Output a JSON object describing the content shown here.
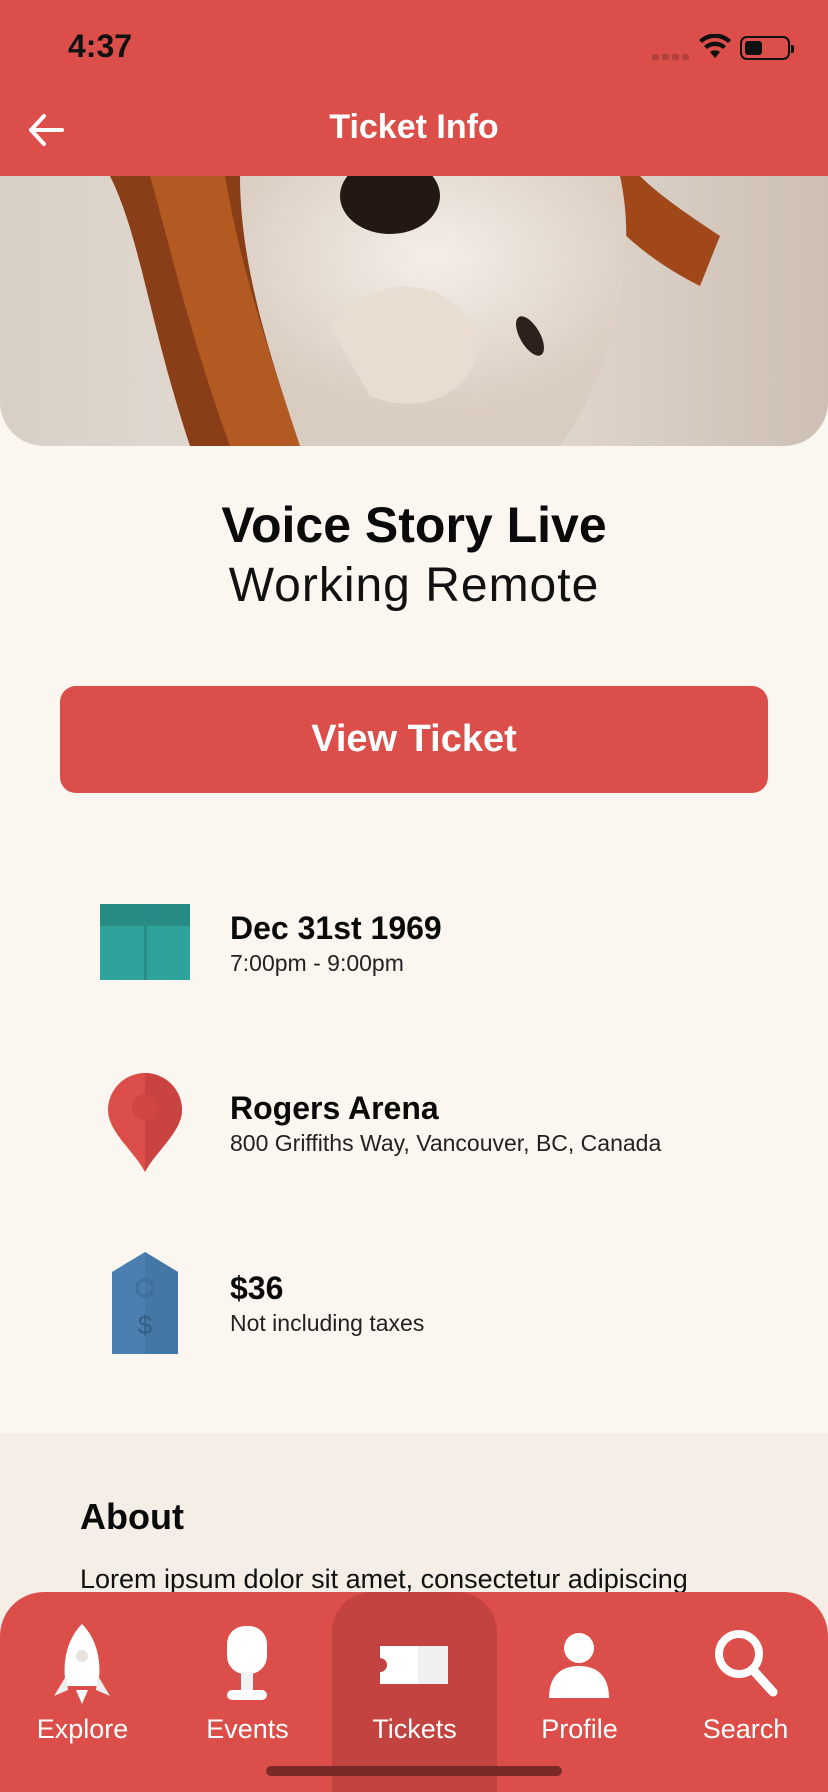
{
  "status_bar": {
    "time": "4:37"
  },
  "header": {
    "title": "Ticket Info"
  },
  "event": {
    "name": "Voice Story Live",
    "subtitle": "Working Remote"
  },
  "actions": {
    "view_ticket": "View Ticket"
  },
  "details": {
    "date": {
      "title": "Dec 31st 1969",
      "subtitle": "7:00pm - 9:00pm",
      "icon": "calendar-icon"
    },
    "location": {
      "title": "Rogers Arena",
      "subtitle": "800 Griffiths Way, Vancouver, BC, Canada",
      "icon": "map-pin-icon"
    },
    "price": {
      "title": "$36",
      "subtitle": "Not including taxes",
      "icon": "price-tag-icon"
    }
  },
  "about": {
    "heading": "About",
    "text": "Lorem ipsum dolor sit amet, consectetur adipiscing"
  },
  "tabbar": {
    "active": "Tickets",
    "items": [
      {
        "label": "Explore",
        "icon": "rocket-icon"
      },
      {
        "label": "Events",
        "icon": "microphone-icon"
      },
      {
        "label": "Tickets",
        "icon": "ticket-icon"
      },
      {
        "label": "Profile",
        "icon": "person-icon"
      },
      {
        "label": "Search",
        "icon": "search-icon"
      }
    ]
  },
  "colors": {
    "brand": "#DC4E49",
    "background": "#FBF7F0",
    "calendar": "#2EA39B",
    "pin": "#DC4E49",
    "tag": "#4A7FB0"
  }
}
